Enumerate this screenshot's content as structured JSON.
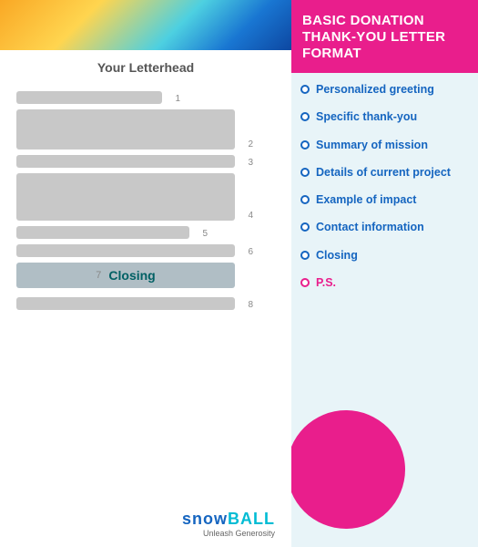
{
  "header": {
    "title": "BASIC DONATION THANK-YOU LETTER FORMAT"
  },
  "letterhead": {
    "title": "Your Letterhead"
  },
  "items": [
    {
      "number": "1",
      "label": "Personalized greeting"
    },
    {
      "number": "2",
      "label": "Specific thank-you"
    },
    {
      "number": "3",
      "label": "Summary of mission"
    },
    {
      "number": "4",
      "label": "Details of current project"
    },
    {
      "number": "5",
      "label": "Example of impact"
    },
    {
      "number": "6",
      "label": "Contact information"
    },
    {
      "number": "7",
      "label": "Closing"
    },
    {
      "number": "8",
      "label": "P.S."
    }
  ],
  "logo": {
    "name": "snowball",
    "tagline": "Unleash Generosity"
  },
  "row7_closing": "Closing"
}
